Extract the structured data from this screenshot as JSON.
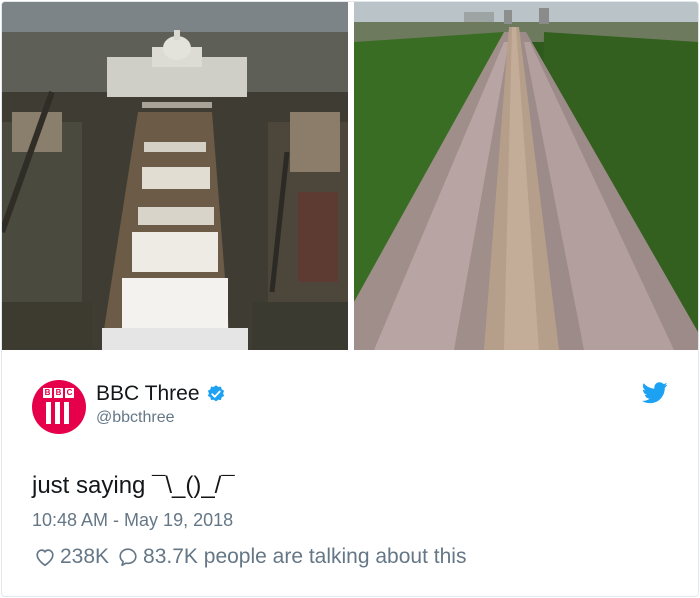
{
  "media": {
    "photo_left": "crowd-photo-inauguration",
    "photo_right": "crowd-photo-royal-wedding"
  },
  "author": {
    "display_name": "BBC Three",
    "handle": "@bbcthree",
    "avatar_letters": [
      "B",
      "B",
      "C"
    ],
    "verified_icon": "verified-badge-icon"
  },
  "tweet": {
    "text": "just saying ¯\\_()_/¯",
    "timestamp": "10:48 AM - May 19, 2018"
  },
  "stats": {
    "likes": "238K",
    "replies": "83.7K people are talking about this"
  },
  "colors": {
    "twitter_blue": "#1da1f2",
    "avatar_red": "#e6004c",
    "secondary_text": "#657786"
  },
  "icons": {
    "like": "heart-icon",
    "reply": "speech-bubble-icon",
    "brand": "twitter-bird-icon"
  }
}
